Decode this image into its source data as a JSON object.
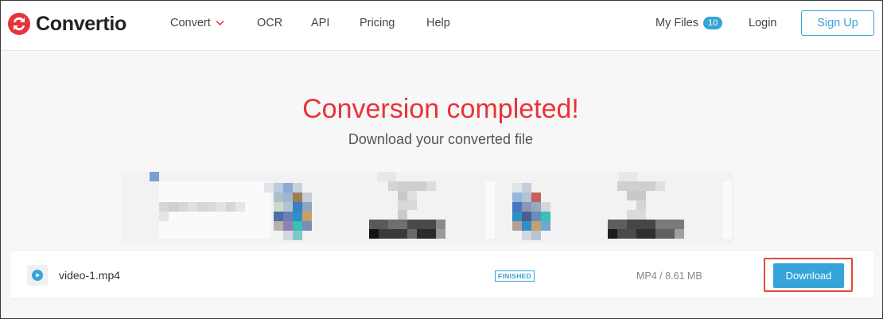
{
  "brand": {
    "name": "Convertio",
    "color": "#e8333a"
  },
  "nav": {
    "convert": "Convert",
    "ocr": "OCR",
    "api": "API",
    "pricing": "Pricing",
    "help": "Help",
    "my_files": "My Files",
    "my_files_count": "10",
    "login": "Login",
    "signup": "Sign Up"
  },
  "main": {
    "title": "Conversion completed!",
    "subtitle": "Download your converted file"
  },
  "file": {
    "name": "video-1.mp4",
    "status": "FINISHED",
    "meta": "MP4 / 8.61 MB",
    "download_label": "Download"
  },
  "colors": {
    "accent": "#36a3d9",
    "title_red": "#e8333a",
    "highlight_box": "#e04b3a"
  }
}
